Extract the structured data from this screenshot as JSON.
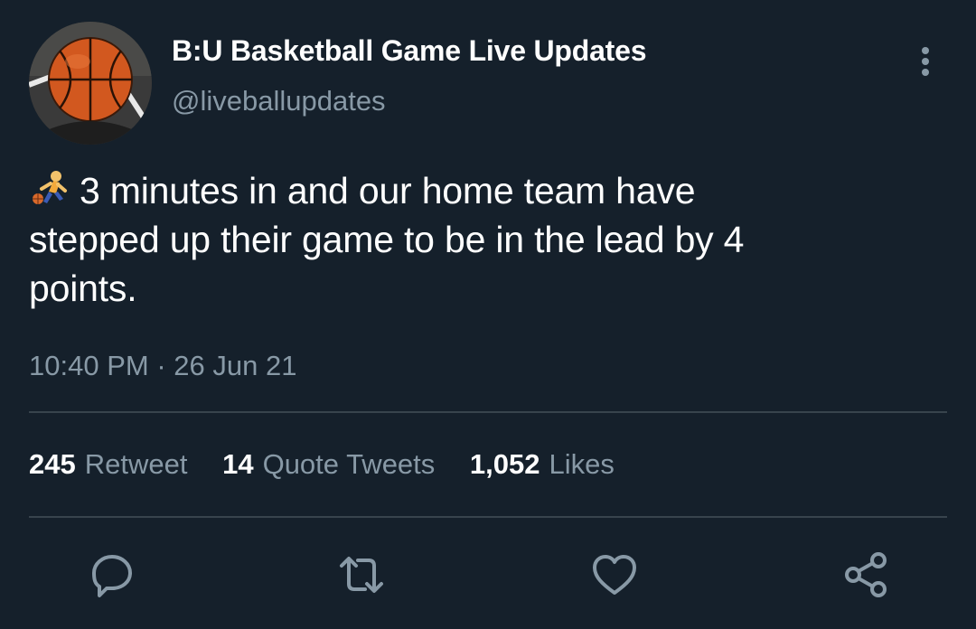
{
  "tweet": {
    "display_name": "B:U Basketball Game Live Updates",
    "handle": "@liveballupdates",
    "emoji": "person-bouncing-ball-emoji",
    "text_line1": "3 minutes in and our home team have",
    "text_line2": "stepped up their game to be in the lead by 4",
    "text_line3": "points.",
    "time": "10:40 PM",
    "separator": "·",
    "date": "26 Jun 21"
  },
  "stats": {
    "retweets_count": "245",
    "retweets_label": "Retweet",
    "quotes_count": "14",
    "quotes_label": "Quote Tweets",
    "likes_count": "1,052",
    "likes_label": "Likes"
  },
  "actions": {
    "icons": [
      "reply-icon",
      "retweet-icon",
      "like-icon",
      "share-icon"
    ]
  },
  "colors": {
    "background": "#15202b",
    "primary_text": "#ffffff",
    "secondary_text": "#8899a6",
    "divider": "#38444d"
  }
}
